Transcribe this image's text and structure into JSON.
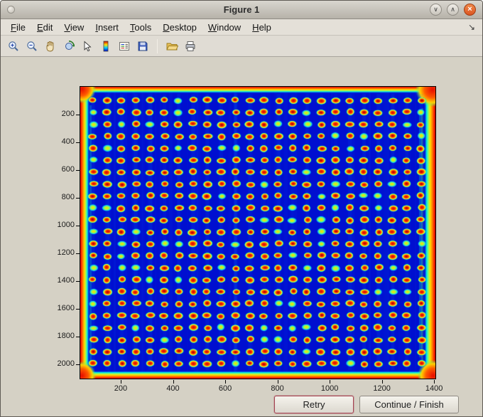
{
  "window": {
    "title": "Figure 1",
    "controls": {
      "shade_glyph": "∨",
      "maximize_glyph": "∧",
      "close_glyph": "×"
    }
  },
  "menu": {
    "items": [
      "File",
      "Edit",
      "View",
      "Insert",
      "Tools",
      "Desktop",
      "Window",
      "Help"
    ],
    "dock_glyph": "↘"
  },
  "toolbar": {
    "icons": [
      "zoom-in",
      "zoom-out",
      "pan-hand",
      "rotate-3d",
      "data-cursor",
      "insert-colorbar",
      "insert-legend",
      "save-figure",
      "open-file",
      "print-figure"
    ]
  },
  "plot": {
    "y_ticks": [
      "200",
      "400",
      "600",
      "800",
      "1000",
      "1200",
      "1400",
      "1600",
      "1800",
      "2000"
    ],
    "x_ticks": [
      "200",
      "400",
      "600",
      "800",
      "1000",
      "1200",
      "1400"
    ],
    "heatmap": {
      "description": "microarray plate image, jet colormap, red spots on blue background",
      "rows": 23,
      "cols": 24,
      "colormap": "jet",
      "seed": 42,
      "background_color": "#000fd0"
    }
  },
  "buttons": {
    "retry_label": "Retry",
    "continue_label": "Continue / Finish"
  },
  "colors": {
    "close_button": "#dc5522",
    "figure_background": "#d5d1c5",
    "retry_outline": "#a54454"
  }
}
